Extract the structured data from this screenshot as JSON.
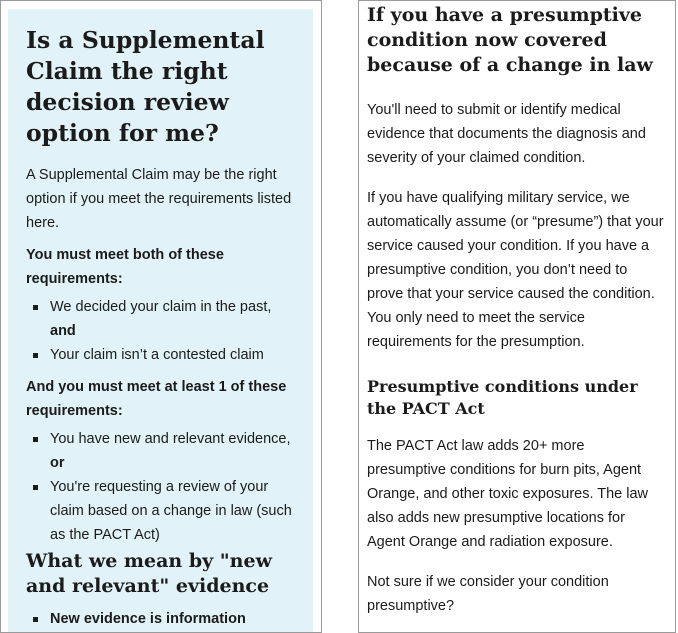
{
  "left": {
    "title": "Is a Supplemental Claim the right decision review option for me?",
    "intro": "A Supplemental Claim may be the right option if you meet the requirements listed here.",
    "req_all_heading": "You must meet both of these requirements:",
    "req_all_items": [
      {
        "text": "We decided your claim in the past, ",
        "suffix": "and"
      },
      {
        "text": "Your claim isn’t a contested claim",
        "suffix": ""
      }
    ],
    "req_one_heading": "And you must meet at least 1 of these requirements:",
    "req_one_items": [
      {
        "text": "You have new and relevant evidence, ",
        "suffix": "or"
      },
      {
        "text": "You're requesting a review of your claim based on a change in law (such as the PACT Act)",
        "suffix": ""
      }
    ],
    "section2_title": "What we mean by \"new and relevant\" evidence",
    "section2_partial": "New evidence is information"
  },
  "right": {
    "title": "If you have a presumptive condition now covered because of a change in law",
    "p1": "You'll need to submit or identify medical evidence that documents the diagnosis and severity of your claimed condition.",
    "p2": "If you have qualifying military service, we automatically assume (or “presume”) that your service caused your condition. If you have a presumptive condition, you don’t need to prove that your service caused the condition. You only need to meet the service requirements for the presumption.",
    "subtitle": "Presumptive conditions under the PACT Act",
    "p3": "The PACT Act law adds 20+ more presumptive conditions for burn pits, Agent Orange, and other toxic exposures. The law also adds new presumptive locations for Agent Orange and radiation exposure.",
    "p4": "Not sure if we consider your condition presumptive?"
  }
}
